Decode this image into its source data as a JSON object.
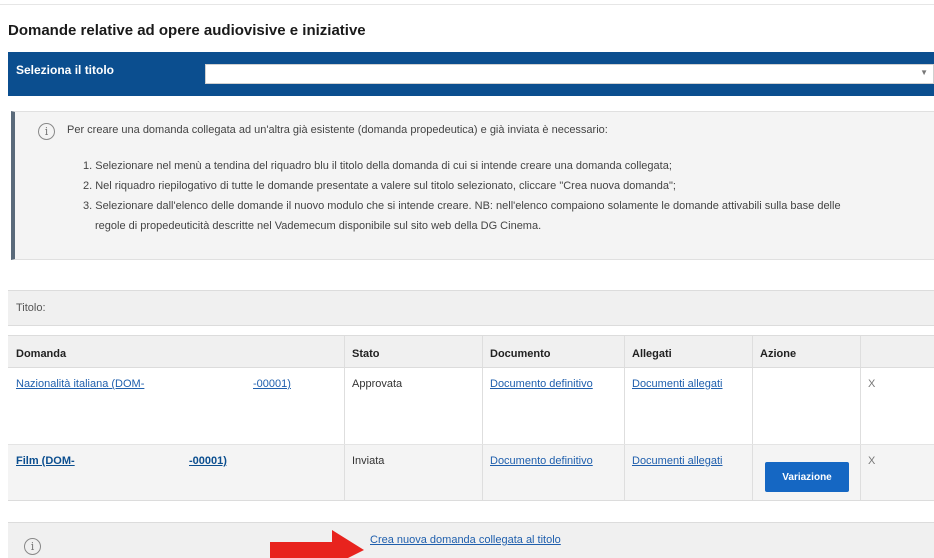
{
  "page": {
    "title": "Domande relative ad opere audiovisive e iniziative"
  },
  "selector": {
    "label": "Seleziona il titolo",
    "value": ""
  },
  "info": {
    "intro": "Per creare una domanda collegata ad un'altra già esistente (domanda propedeutica) e già inviata è necessario:",
    "steps": [
      "1. Selezionare nel menù a tendina del riquadro blu il titolo della domanda di cui si intende creare una domanda collegata;",
      "2. Nel riquadro riepilogativo di tutte le domande presentate a valere sul titolo selezionato, cliccare \"Crea nuova domanda\";",
      "3. Selezionare dall'elenco delle domande il nuovo modulo che si intende creare. NB: nell'elenco compaiono solamente le domande attivabili sulla base delle",
      "regole di propedeuticità descritte nel Vademecum disponibile sul sito web della DG Cinema."
    ]
  },
  "titolo": {
    "label": "Titolo:"
  },
  "table": {
    "headers": {
      "domanda": "Domanda",
      "stato": "Stato",
      "documento": "Documento",
      "allegati": "Allegati",
      "azione": "Azione"
    },
    "rows": [
      {
        "domanda_prefix": "Nazionalità italiana (DOM-",
        "domanda_suffix": "-00001)",
        "stato": "Approvata",
        "documento": "Documento definitivo",
        "allegati": "Documenti allegati",
        "azione": "",
        "remove": "X"
      },
      {
        "domanda_prefix": "Film (DOM-",
        "domanda_suffix": "-00001)",
        "stato": "Inviata",
        "documento": "Documento definitivo",
        "allegati": "Documenti allegati",
        "azione": "Variazione",
        "remove": "X"
      }
    ]
  },
  "footer": {
    "link": "Crea nuova domanda collegata al titolo"
  },
  "colors": {
    "brand_blue": "#0b4e8f",
    "button_blue": "#1567c3",
    "arrow_red": "#e8231e",
    "link": "#1f5fad"
  },
  "icons": {
    "info": "info-circle-icon",
    "arrow": "red-arrow-right-icon"
  }
}
